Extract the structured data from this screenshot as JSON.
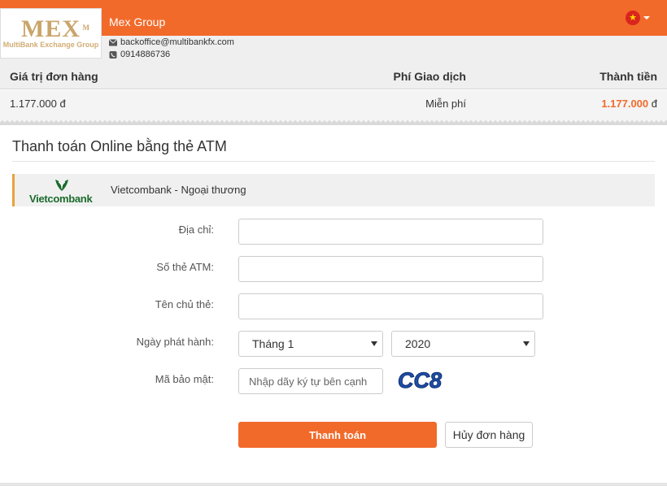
{
  "header": {
    "logo_text": "MEX",
    "logo_tm": "M",
    "logo_tagline": "MultiBank Exchange Group",
    "merchant_name": "Mex Group",
    "email": "backoffice@multibankfx.com",
    "phone": "0914886736",
    "language_flag": "vietnam-flag-icon"
  },
  "summary": {
    "headers": [
      "Giá trị đơn hàng",
      "Phí Giao dịch",
      "Thành tiền"
    ],
    "order_value": "1.177.000 đ",
    "fee": "Miễn phí",
    "total_amount": "1.177.000",
    "total_currency": " đ"
  },
  "payment": {
    "title": "Thanh toán Online bằng thẻ ATM",
    "bank_logo_text": "Vietcombank",
    "bank_name": "Vietcombank - Ngoại thương"
  },
  "form": {
    "address_label": "Địa chỉ:",
    "address_value": "",
    "card_number_label": "Số thẻ ATM:",
    "card_number_value": "",
    "holder_label": "Tên chủ thẻ:",
    "holder_value": "",
    "issue_date_label": "Ngày phát hành:",
    "month_selected": "Tháng 1",
    "year_selected": "2020",
    "security_label": "Mã bảo mật:",
    "security_placeholder": "Nhập dãy ký tự bên cạnh",
    "captcha_text": "CC8"
  },
  "actions": {
    "pay_label": "Thanh toán",
    "cancel_label": "Hủy đơn hàng"
  },
  "colors": {
    "accent": "#f26a2a",
    "bank_green": "#1b6b2c",
    "captcha_blue": "#1f4fa8"
  }
}
